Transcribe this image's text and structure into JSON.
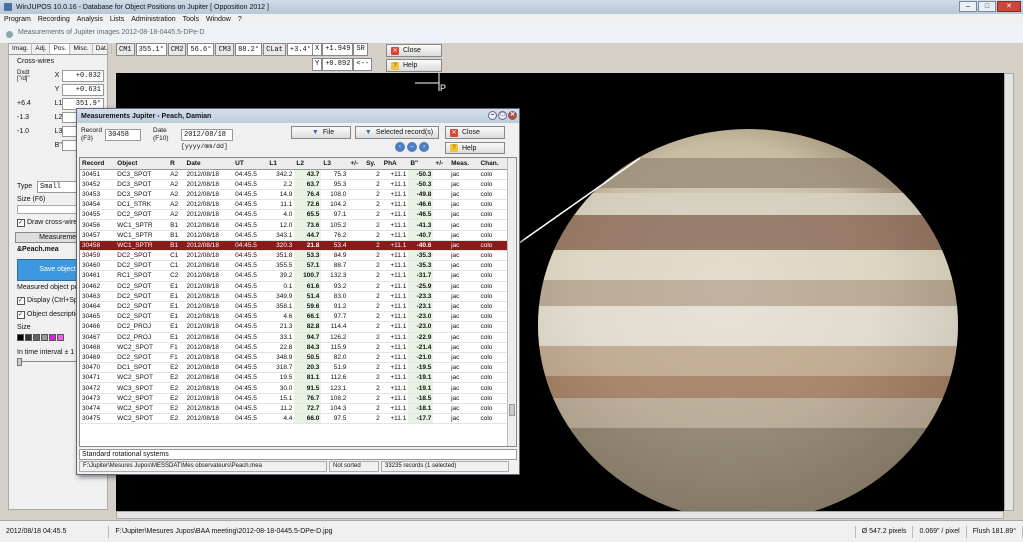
{
  "app": {
    "title": "WinJUPOS 10.0.16 - Database for Object Positions on Jupiter  [ Opposition 2012 ]"
  },
  "menu": [
    "Program",
    "Recording",
    "Analysis",
    "Lists",
    "Administration",
    "Tools",
    "Window",
    "?"
  ],
  "window": {
    "subtitle": "Measurements of Jupiter images  2012-08-18-0445.5-DPe-D"
  },
  "readouts": {
    "cm1": "CM1",
    "cm1_val": "355.1°",
    "cm2": "CM2",
    "cm2_val": "56.6°",
    "cm3": "CM3",
    "cm3_val": "88.2°",
    "clat": "CLat",
    "clat_val": "+3.4°",
    "x_label": "X",
    "x_val": "+1.949",
    "y_label": "Y",
    "y_val": "+0.892",
    "sr": "SR",
    "arrows": "<--"
  },
  "buttons": {
    "close": "Close",
    "help": "Help"
  },
  "left": {
    "tabs": [
      "Imag.",
      "Adj.",
      "Pos.",
      "Misc.",
      "Dat."
    ],
    "active_tab": "Pos.",
    "crosswires_title": "Cross-wires",
    "dxdy_label": "Dxdt\n[\"/d]\"",
    "x_label": "X",
    "x_val": "+0.032",
    "y_label": "Y",
    "y_val": "+0.631",
    "l1_label": "L1",
    "l1_val": "351.9°",
    "l1_offset": "+6.4",
    "l2_label": "L2",
    "l3_label": "L3",
    "b_label": "B\"",
    "neg1": "-1.3",
    "neg2": "-1.0",
    "type_label": "Type",
    "type_val": "Small",
    "size_label": "Size (F6)",
    "draw_label": "Draw cross-wires (Sp",
    "measure_label": "Measurement",
    "file_label": "&Peach.mea",
    "save_label": "Save object p",
    "measured_title": "Measured object positi",
    "display_label": "Display (Ctrl+Space",
    "desc_label": "Object descriptions",
    "size2_label": "Size",
    "interval_label": "In time interval ± 1 minu"
  },
  "dialog": {
    "title": "Measurements Jupiter - Peach, Damian",
    "record_label": "Record\n(F3)",
    "record_val": "30458",
    "date_label": "Date\n(F10)",
    "date_val": "2012/08/18",
    "date_format": "[yyyy/mm/dd]",
    "file_btn": "File",
    "selected_btn": "Selected record(s)",
    "close_btn": "Close",
    "help_btn": "Help",
    "columns": [
      "Record",
      "Object",
      "R",
      "Date",
      "UT",
      "L1",
      "L2",
      "L3",
      "+/-",
      "Sy.",
      "PhA",
      "B\"",
      "+/-",
      "Meas.",
      "Chan."
    ],
    "rows": [
      [
        "30451",
        "DC3_SPOT",
        "A2",
        "2012/08/18",
        "04:45.5",
        "342.2",
        "43.7",
        "75.3",
        "",
        "2",
        "+11.1",
        "-50.3",
        "",
        "jac",
        "colo"
      ],
      [
        "30452",
        "DC3_SPOT",
        "A2",
        "2012/08/18",
        "04:45.5",
        "2.2",
        "63.7",
        "95.3",
        "",
        "2",
        "+11.1",
        "-50.3",
        "",
        "jac",
        "colo"
      ],
      [
        "30453",
        "DC3_SPOT",
        "A2",
        "2012/08/18",
        "04:45.5",
        "14.9",
        "76.4",
        "108.0",
        "",
        "2",
        "+11.1",
        "-49.8",
        "",
        "jac",
        "colo"
      ],
      [
        "30454",
        "DC1_STRK",
        "A2",
        "2012/08/18",
        "04:45.5",
        "11.1",
        "72.6",
        "104.2",
        "",
        "2",
        "+11.1",
        "-46.6",
        "",
        "jac",
        "colo"
      ],
      [
        "30455",
        "DC2_SPOT",
        "A2",
        "2012/08/18",
        "04:45.5",
        "4.0",
        "65.5",
        "97.1",
        "",
        "2",
        "+11.1",
        "-46.5",
        "",
        "jac",
        "colo"
      ],
      [
        "30456",
        "WC1_SPTR",
        "B1",
        "2012/08/18",
        "04:45.5",
        "12.0",
        "73.6",
        "105.2",
        "",
        "2",
        "+11.1",
        "-41.3",
        "",
        "jac",
        "colo"
      ],
      [
        "30457",
        "WC1_SPTR",
        "B1",
        "2012/08/18",
        "04:45.5",
        "343.1",
        "44.7",
        "76.2",
        "",
        "2",
        "+11.1",
        "-40.7",
        "",
        "jac",
        "colo"
      ],
      [
        "30458",
        "WC1_SPTR",
        "B1",
        "2012/08/18",
        "04:45.5",
        "320.3",
        "21.8",
        "53.4",
        "",
        "2",
        "+11.1",
        "-40.6",
        "",
        "jac",
        "colo"
      ],
      [
        "30459",
        "DC2_SPOT",
        "C1",
        "2012/08/18",
        "04:45.5",
        "351.8",
        "53.3",
        "84.9",
        "",
        "2",
        "+11.1",
        "-35.3",
        "",
        "jac",
        "colo"
      ],
      [
        "30460",
        "DC2_SPOT",
        "C1",
        "2012/08/18",
        "04:45.5",
        "355.5",
        "57.1",
        "88.7",
        "",
        "2",
        "+11.1",
        "-35.3",
        "",
        "jac",
        "colo"
      ],
      [
        "30461",
        "RC1_SPOT",
        "C2",
        "2012/08/18",
        "04:45.5",
        "39.2",
        "100.7",
        "132.3",
        "",
        "2",
        "+11.1",
        "-31.7",
        "",
        "jac",
        "colo"
      ],
      [
        "30462",
        "DC2_SPOT",
        "E1",
        "2012/08/18",
        "04:45.5",
        "0.1",
        "61.6",
        "93.2",
        "",
        "2",
        "+11.1",
        "-25.9",
        "",
        "jac",
        "colo"
      ],
      [
        "30463",
        "DC2_SPOT",
        "E1",
        "2012/08/18",
        "04:45.5",
        "349.9",
        "51.4",
        "83.0",
        "",
        "2",
        "+11.1",
        "-23.3",
        "",
        "jac",
        "colo"
      ],
      [
        "30464",
        "DC2_SPOT",
        "E1",
        "2012/08/18",
        "04:45.5",
        "358.1",
        "59.6",
        "91.2",
        "",
        "2",
        "+11.1",
        "-23.1",
        "",
        "jac",
        "colo"
      ],
      [
        "30465",
        "DC2_SPOT",
        "E1",
        "2012/08/18",
        "04:45.5",
        "4.6",
        "66.1",
        "97.7",
        "",
        "2",
        "+11.1",
        "-23.0",
        "",
        "jac",
        "colo"
      ],
      [
        "30466",
        "DC2_PROJ",
        "E1",
        "2012/08/18",
        "04:45.5",
        "21.3",
        "82.8",
        "114.4",
        "",
        "2",
        "+11.1",
        "-23.0",
        "",
        "jac",
        "colo"
      ],
      [
        "30467",
        "DC2_PROJ",
        "E1",
        "2012/08/18",
        "04:45.5",
        "33.1",
        "94.7",
        "126.2",
        "",
        "2",
        "+11.1",
        "-22.9",
        "",
        "jac",
        "colo"
      ],
      [
        "30468",
        "WC2_SPOT",
        "F1",
        "2012/08/18",
        "04:45.5",
        "22.8",
        "84.3",
        "115.9",
        "",
        "2",
        "+11.1",
        "-21.4",
        "",
        "jac",
        "colo"
      ],
      [
        "30469",
        "DC2_SPOT",
        "F1",
        "2012/08/18",
        "04:45.5",
        "348.9",
        "50.5",
        "82.0",
        "",
        "2",
        "+11.1",
        "-21.0",
        "",
        "jac",
        "colo"
      ],
      [
        "30470",
        "DC1_SPOT",
        "E2",
        "2012/08/18",
        "04:45.5",
        "318.7",
        "20.3",
        "51.9",
        "",
        "2",
        "+11.1",
        "-19.5",
        "",
        "jac",
        "colo"
      ],
      [
        "30471",
        "WC2_SPOT",
        "E2",
        "2012/08/18",
        "04:45.5",
        "19.5",
        "81.1",
        "112.6",
        "",
        "2",
        "+11.1",
        "-19.1",
        "",
        "jac",
        "colo"
      ],
      [
        "30472",
        "WC3_SPOT",
        "E2",
        "2012/08/18",
        "04:45.5",
        "30.0",
        "91.5",
        "123.1",
        "",
        "2",
        "+11.1",
        "-19.1",
        "",
        "jac",
        "colo"
      ],
      [
        "30473",
        "WC2_SPOT",
        "E2",
        "2012/08/18",
        "04:45.5",
        "15.1",
        "76.7",
        "108.2",
        "",
        "2",
        "+11.1",
        "-18.5",
        "",
        "jac",
        "colo"
      ],
      [
        "30474",
        "WC2_SPOT",
        "E2",
        "2012/08/18",
        "04:45.5",
        "11.2",
        "72.7",
        "104.3",
        "",
        "2",
        "+11.1",
        "-18.1",
        "",
        "jac",
        "colo"
      ],
      [
        "30475",
        "WC2_SPOT",
        "E2",
        "2012/08/18",
        "04:45.5",
        "4.4",
        "66.0",
        "97.5",
        "",
        "2",
        "+11.1",
        "-17.7",
        "",
        "jac",
        "colo"
      ]
    ],
    "selected_record": "30458",
    "systems": "Standard rotational systems",
    "path": "F:\\Jupiter\\Mesures Jupos\\MESSDAT\\Mes observateurs\\Peach.mea",
    "sort": "Not sorted",
    "count": "33235 records (1 selected)"
  },
  "image": {
    "p_label": "P"
  },
  "status": {
    "datetime": "2012/08/18   04:45.5",
    "file": "F:\\Jupiter\\Mesures Jupos\\BAA meeting\\2012-08-18-0445.5-DPe-D.jpg",
    "diameter": "Ø 547.2 pixels",
    "scale": "0.069\" / pixel",
    "flush": "Flush 181.89°"
  },
  "colors": {
    "selected_row": "#8b1a1a",
    "grid_highlight": "#e8f3e4",
    "accent": "#3a6ea5"
  }
}
